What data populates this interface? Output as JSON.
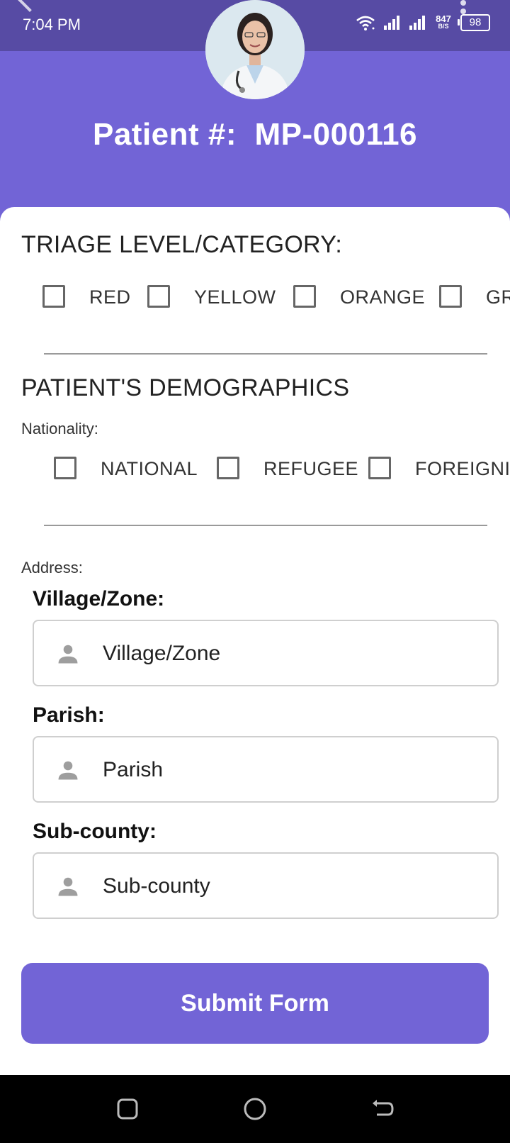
{
  "status_bar": {
    "time": "7:04 PM",
    "net_speed_value": "847",
    "net_speed_unit": "B/S",
    "battery": "98"
  },
  "header": {
    "patient_label": "Patient #:",
    "patient_id": "MP-000116"
  },
  "triage": {
    "title": "TRIAGE LEVEL/CATEGORY:",
    "options": [
      "RED",
      "YELLOW",
      "ORANGE",
      "GR"
    ]
  },
  "demographics": {
    "title": "PATIENT'S DEMOGRAPHICS",
    "nationality_label": "Nationality:",
    "nationality_options": [
      "NATIONAL",
      "REFUGEE",
      "FOREIGNI"
    ]
  },
  "address": {
    "label": "Address:",
    "fields": [
      {
        "label": "Village/Zone:",
        "placeholder": "Village/Zone"
      },
      {
        "label": "Parish:",
        "placeholder": "Parish"
      },
      {
        "label": "Sub-county:",
        "placeholder": "Sub-county"
      }
    ]
  },
  "submit": {
    "label": "Submit Form"
  },
  "colors": {
    "primary": "#7264D6",
    "status_bar": "#574BA4"
  }
}
